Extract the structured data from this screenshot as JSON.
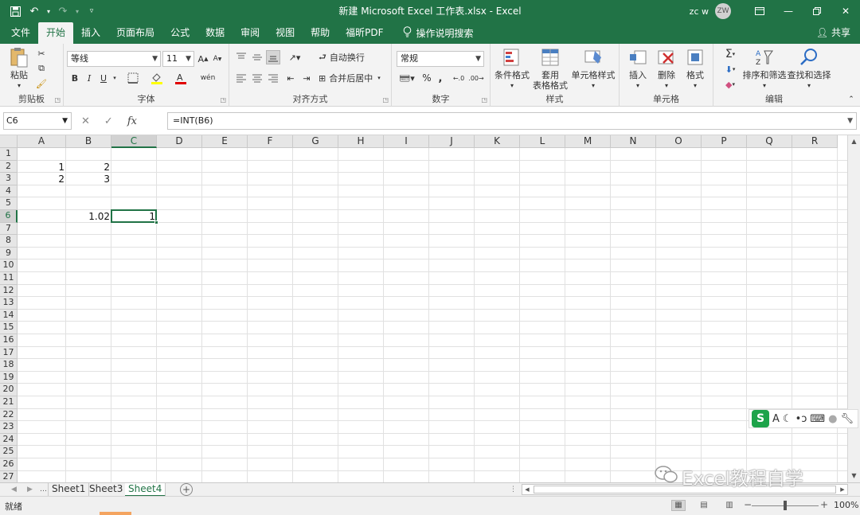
{
  "window": {
    "title": "新建 Microsoft Excel 工作表.xlsx  -  Excel",
    "user_name": "zc w",
    "avatar_initials": "ZW"
  },
  "tabs": [
    "文件",
    "开始",
    "插入",
    "页面布局",
    "公式",
    "数据",
    "审阅",
    "视图",
    "帮助",
    "福昕PDF"
  ],
  "active_tab": "开始",
  "tell_me": "操作说明搜索",
  "share": "共享",
  "ribbon": {
    "clipboard": {
      "label": "剪贴板",
      "paste": "粘贴"
    },
    "font": {
      "label": "字体",
      "name": "等线",
      "size": "11",
      "bold": "B",
      "italic": "I",
      "underline": "U",
      "grow": "A",
      "shrink": "A"
    },
    "alignment": {
      "label": "对齐方式",
      "wrap": "自动换行",
      "merge": "合并后居中"
    },
    "number": {
      "label": "数字",
      "format": "常规",
      "percent": "%",
      "comma": ","
    },
    "styles": {
      "label": "样式",
      "conditional": "条件格式",
      "table": "套用\n表格格式",
      "cell_styles": "单元格样式"
    },
    "cells": {
      "label": "单元格",
      "insert": "插入",
      "delete": "删除",
      "format": "格式"
    },
    "editing": {
      "label": "编辑",
      "sort": "排序和筛选",
      "find": "查找和选择"
    }
  },
  "formula_bar": {
    "name_box": "C6",
    "formula": "=INT(B6)",
    "fx": "fx"
  },
  "columns": [
    "A",
    "B",
    "C",
    "D",
    "E",
    "F",
    "G",
    "H",
    "I",
    "J",
    "K",
    "L",
    "M",
    "N",
    "O",
    "P",
    "Q",
    "R"
  ],
  "rows": [
    "1",
    "2",
    "3",
    "4",
    "5",
    "6",
    "7",
    "8",
    "9",
    "10",
    "11",
    "12",
    "13",
    "14",
    "15",
    "16",
    "17",
    "18",
    "19",
    "20",
    "21",
    "22",
    "23",
    "24",
    "25",
    "26",
    "27"
  ],
  "cells": {
    "A2": "1",
    "B2": "2",
    "A3": "2",
    "B3": "3",
    "B6": "1.02",
    "C6": "1"
  },
  "selected_cell": {
    "col": "C",
    "row": "6"
  },
  "sheets": [
    "Sheet1",
    "Sheet3",
    "Sheet4"
  ],
  "active_sheet": "Sheet4",
  "status": {
    "text": "就绪",
    "zoom": "100%",
    "zoom_fraction": 0.5
  },
  "watermark": "Excel教程自学",
  "colors": {
    "excel_green": "#217346"
  }
}
